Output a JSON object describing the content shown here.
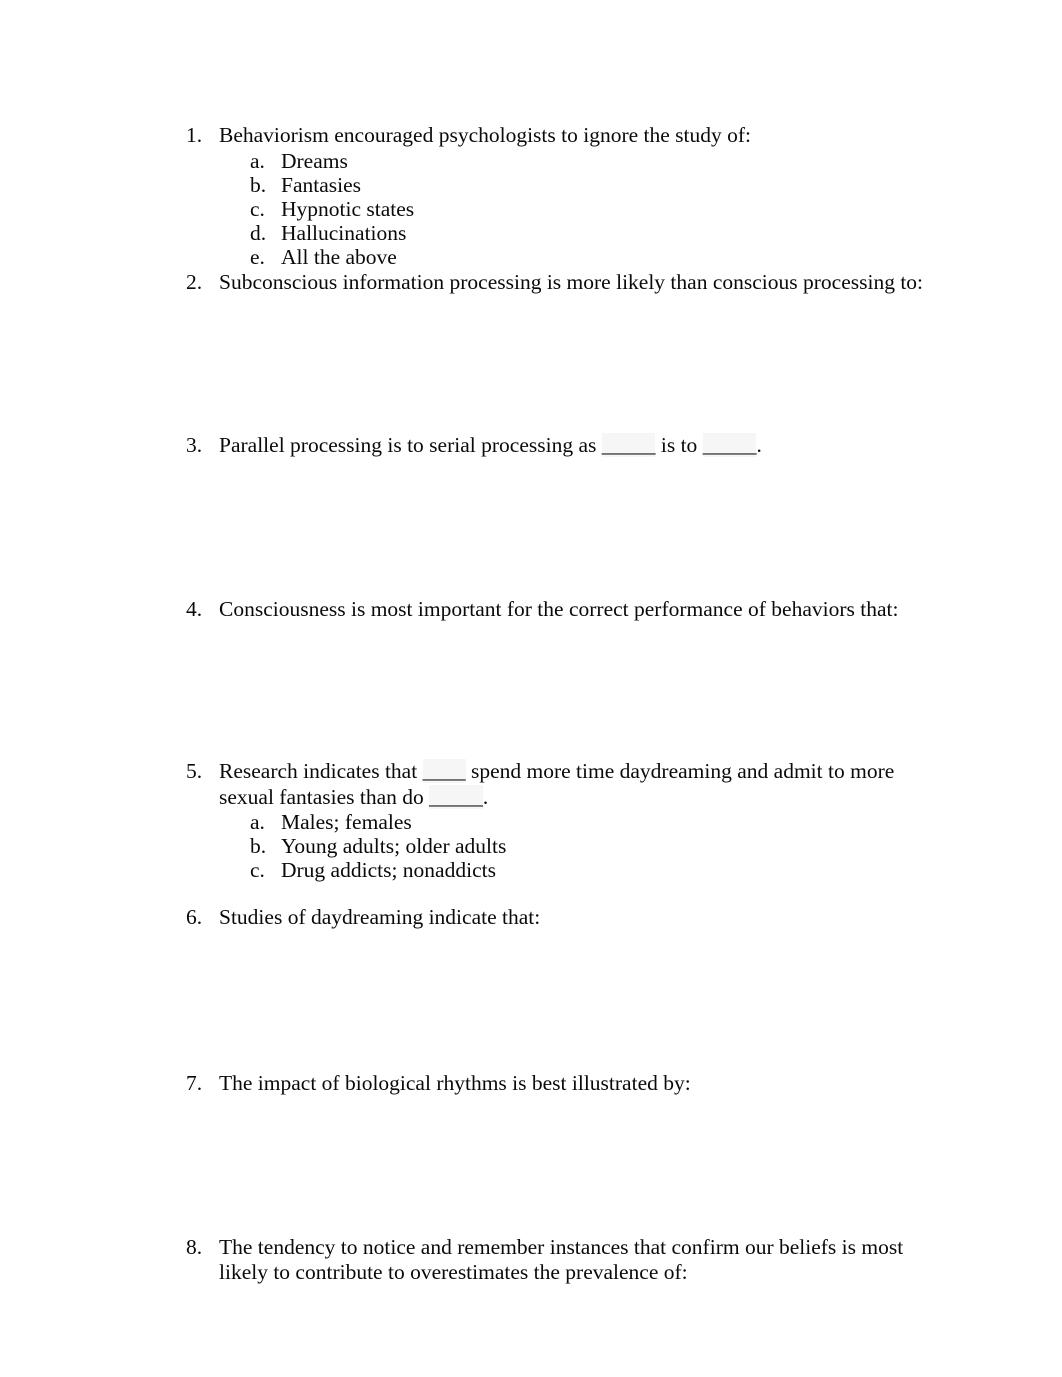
{
  "page": {
    "background_color": "#ffffff",
    "text_color": "#0a0a0a",
    "blank_field_shade_color": "#f6f6f6"
  },
  "questions": [
    {
      "number": "1.",
      "text": "Behaviorism encouraged psychologists to ignore the study of:",
      "options": [
        {
          "marker": "a.",
          "text": "Dreams"
        },
        {
          "marker": "b.",
          "text": "Fantasies"
        },
        {
          "marker": "c.",
          "text": "Hypnotic states"
        },
        {
          "marker": "d.",
          "text": "Hallucinations"
        },
        {
          "marker": "e.",
          "text": "All the above"
        }
      ],
      "answer_space_height": 0
    },
    {
      "number": "2.",
      "text": "Subconscious information processing is more likely than conscious processing to:",
      "options": [],
      "answer_space_height": 138
    },
    {
      "number": "3.",
      "text_parts": [
        {
          "kind": "text",
          "value": "Parallel processing is to serial processing as  "
        },
        {
          "kind": "blank",
          "value": "_____"
        },
        {
          "kind": "text",
          "value": " is to "
        },
        {
          "kind": "blank",
          "value": "_____"
        },
        {
          "kind": "text",
          "value": "."
        }
      ],
      "text": "Parallel processing is to serial processing as  _____ is to _____.",
      "options": [],
      "answer_space_height": 138
    },
    {
      "number": "4.",
      "text": "Consciousness is most important for the correct performance of behaviors that:",
      "options": [],
      "answer_space_height": 137
    },
    {
      "number": "5.",
      "text_parts": [
        {
          "kind": "text",
          "value": "Research indicates that "
        },
        {
          "kind": "blank",
          "value": "____"
        },
        {
          "kind": "text",
          "value": " spend more time daydreaming and admit to more sexual fantasies than do "
        },
        {
          "kind": "blank",
          "value": "_____"
        },
        {
          "kind": "text",
          "value": "."
        }
      ],
      "text": "Research indicates that ____ spend more time daydreaming and admit to more sexual fantasies than do _____.",
      "options": [
        {
          "marker": "a.",
          "text": "Males; females"
        },
        {
          "marker": "b.",
          "text": "Young adults; older adults"
        },
        {
          "marker": "c.",
          "text": "Drug addicts; nonaddicts"
        }
      ],
      "answer_space_height": 22
    },
    {
      "number": "6.",
      "text": "Studies of daydreaming indicate that:",
      "options": [],
      "answer_space_height": 141
    },
    {
      "number": "7.",
      "text": "The impact of biological rhythms is best illustrated by:",
      "options": [],
      "answer_space_height": 138
    },
    {
      "number": "8.",
      "text": "The tendency to notice and remember instances that confirm our beliefs is most likely to contribute to overestimates the prevalence of:",
      "options": [],
      "answer_space_height": 0
    }
  ]
}
